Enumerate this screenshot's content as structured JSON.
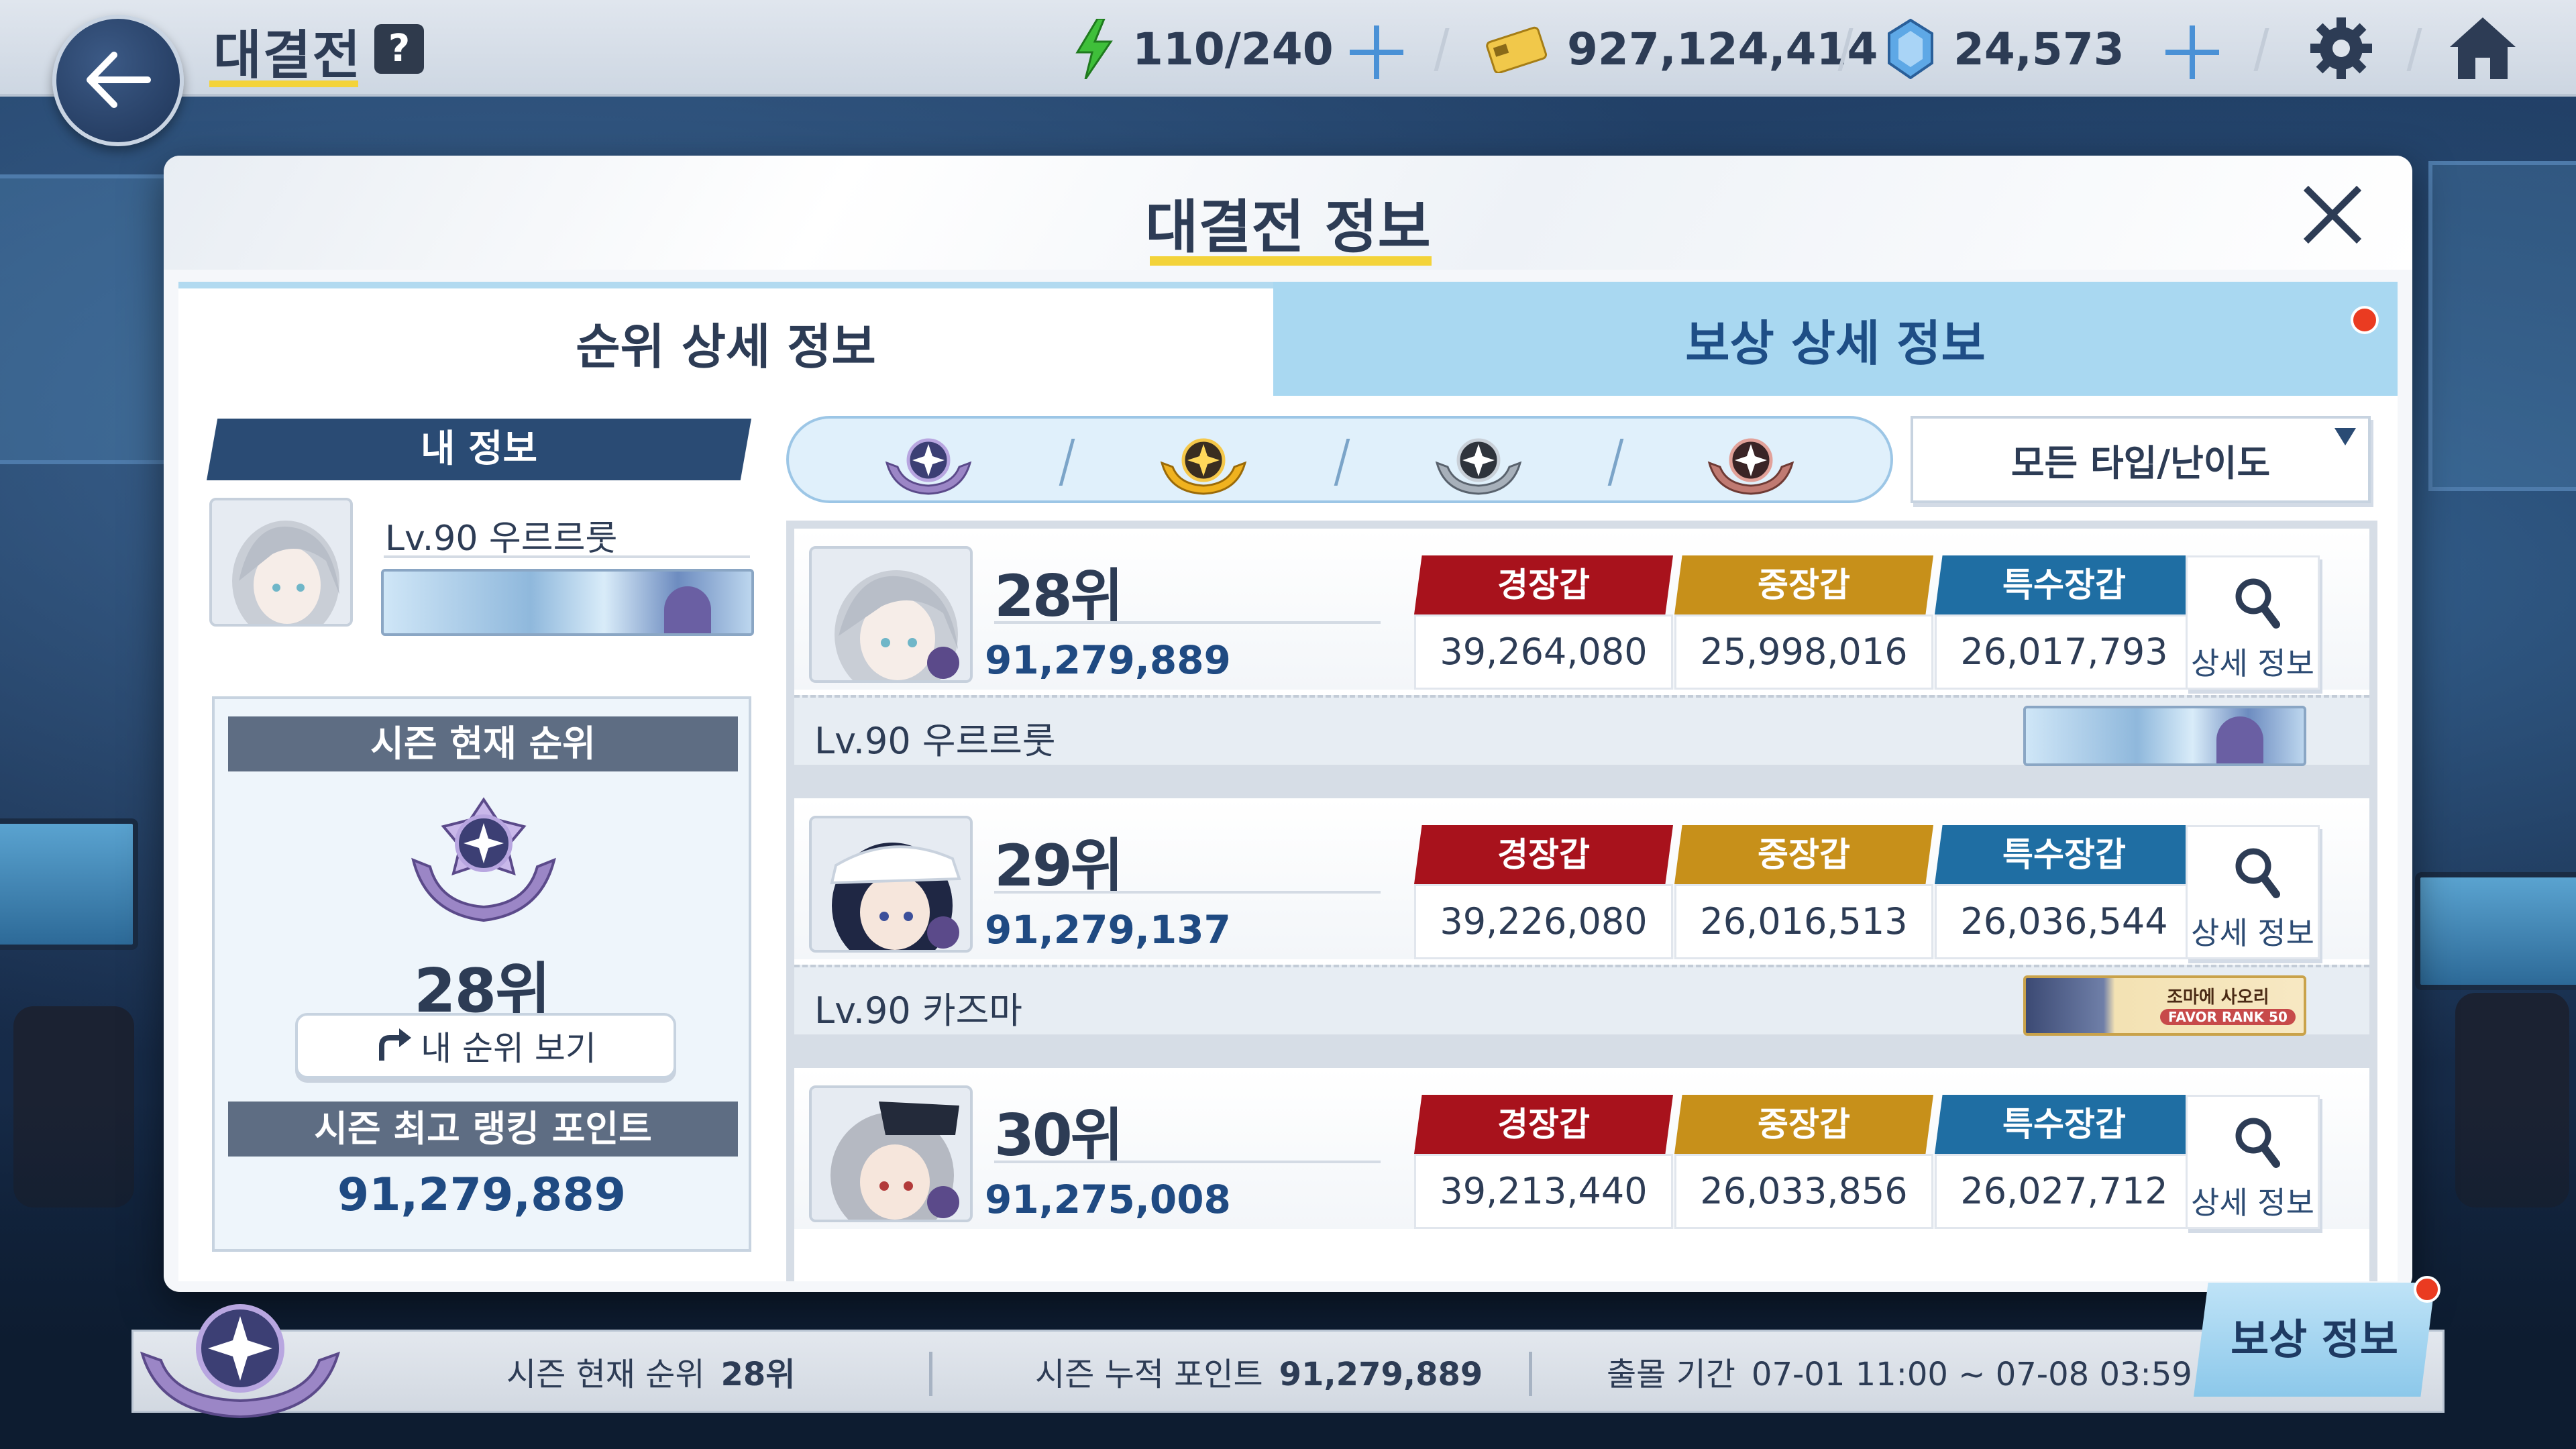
{
  "header": {
    "title": "대결전",
    "help": "?",
    "stamina": "110/240",
    "credits": "927,124,414",
    "pyroxene": "24,573",
    "icons": {
      "back": "arrow-left-icon",
      "stamina": "lightning-icon",
      "credits": "credit-card-icon",
      "pyroxene": "gem-icon",
      "settings": "gear-icon",
      "home": "home-icon"
    }
  },
  "modal": {
    "title": "대결전 정보",
    "tabs": [
      {
        "label": "순위 상세 정보",
        "active": true
      },
      {
        "label": "보상 상세 정보",
        "active": false
      }
    ]
  },
  "my_info": {
    "header": "내 정보",
    "level_name": "Lv.90 우르르룻",
    "season_rank_label": "시즌 현재 순위",
    "rank": "28위",
    "view_my_rank": "내 순위 보기",
    "best_points_label": "시즌 최고 랭킹 포인트",
    "best_points": "91,279,889"
  },
  "filter": {
    "tiers": [
      "platinum-tier-icon",
      "gold-tier-icon",
      "silver-tier-icon",
      "bronze-tier-icon"
    ],
    "dropdown": "모든 타입/난이도"
  },
  "ranking": [
    {
      "rank": "28위",
      "score": "91,279,889",
      "level_name": "Lv.90 우르르룻",
      "armor": [
        {
          "label": "경장갑",
          "value": "39,264,080"
        },
        {
          "label": "중장갑",
          "value": "25,998,016"
        },
        {
          "label": "특수장갑",
          "value": "26,017,793"
        }
      ],
      "detail": "상세 정보"
    },
    {
      "rank": "29위",
      "score": "91,279,137",
      "level_name": "Lv.90 카즈마",
      "armor": [
        {
          "label": "경장갑",
          "value": "39,226,080"
        },
        {
          "label": "중장갑",
          "value": "26,016,513"
        },
        {
          "label": "특수장갑",
          "value": "26,036,544"
        }
      ],
      "detail": "상세 정보",
      "banner_text": "조마에 사오리",
      "banner_badge": "FAVOR RANK 50"
    },
    {
      "rank": "30위",
      "score": "91,275,008",
      "armor": [
        {
          "label": "경장갑",
          "value": "39,213,440"
        },
        {
          "label": "중장갑",
          "value": "26,033,856"
        },
        {
          "label": "특수장갑",
          "value": "26,027,712"
        }
      ],
      "detail": "상세 정보"
    }
  ],
  "footer": {
    "current_rank_label": "시즌 현재 순위",
    "current_rank": "28위",
    "total_points_label": "시즌 누적 포인트",
    "total_points": "91,279,889",
    "period_label": "출몰 기간",
    "period": "07-01 11:00 ~ 07-08 03:59",
    "reward_button": "보상 정보"
  },
  "colors": {
    "light_armor": "#a8121c",
    "heavy_armor": "#c7901a",
    "special_armor": "#1f6ea3",
    "accent_yellow": "#f3d33a",
    "navy": "#2a4b74"
  }
}
